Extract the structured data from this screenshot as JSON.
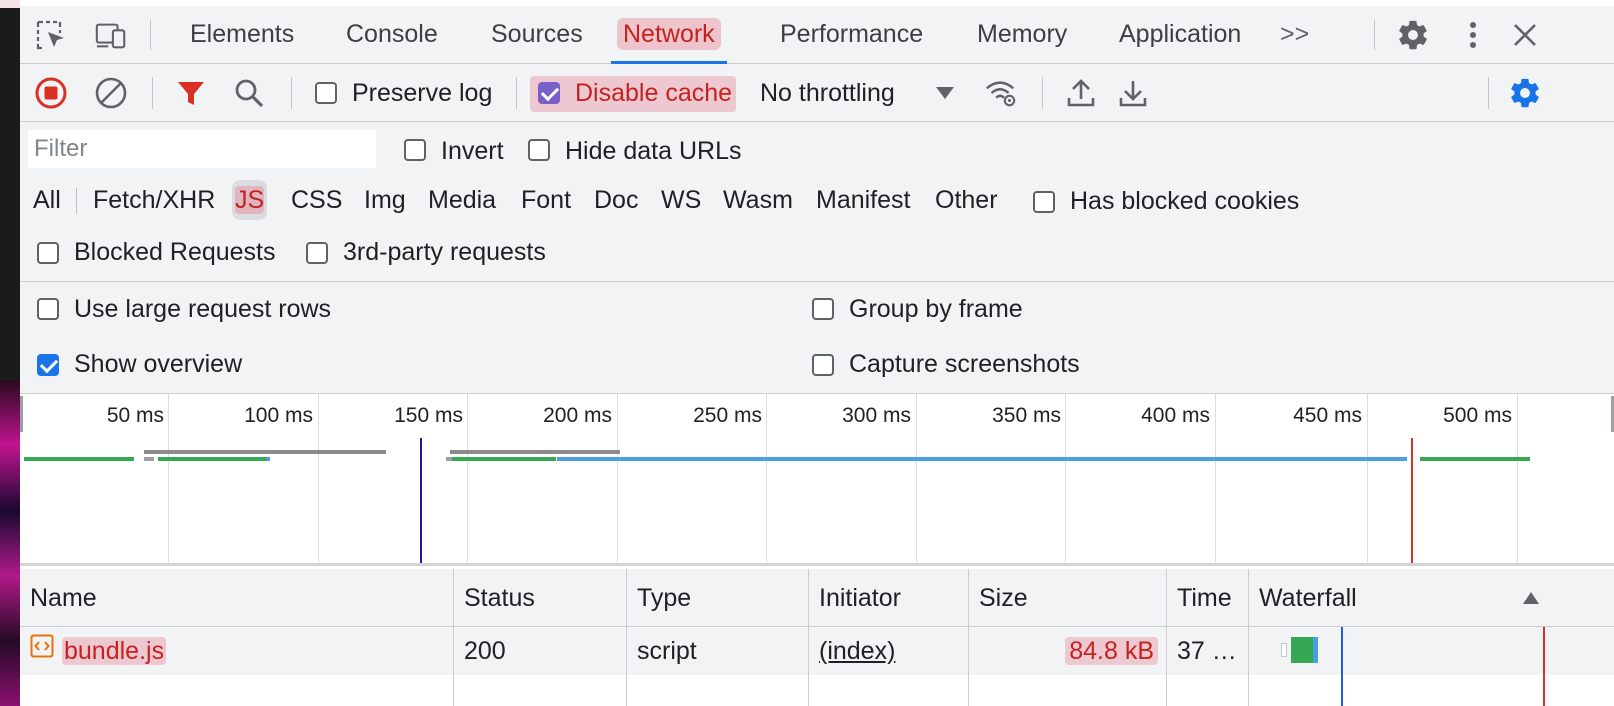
{
  "tabs": {
    "items": [
      "Elements",
      "Console",
      "Sources",
      "Network",
      "Performance",
      "Memory",
      "Application"
    ],
    "active": "Network",
    "more": ">>"
  },
  "toolbar": {
    "preserve_log": "Preserve log",
    "preserve_log_checked": false,
    "disable_cache": "Disable cache",
    "disable_cache_checked": true,
    "throttling": "No throttling"
  },
  "filter": {
    "placeholder": "Filter",
    "invert": "Invert",
    "hide_data_urls": "Hide data URLs",
    "types": [
      "All",
      "Fetch/XHR",
      "JS",
      "CSS",
      "Img",
      "Media",
      "Font",
      "Doc",
      "WS",
      "Wasm",
      "Manifest",
      "Other"
    ],
    "selected_type": "JS",
    "has_blocked_cookies": "Has blocked cookies",
    "blocked_requests": "Blocked Requests",
    "third_party": "3rd-party requests"
  },
  "settings": {
    "large_rows": "Use large request rows",
    "large_rows_checked": false,
    "group_by_frame": "Group by frame",
    "group_by_frame_checked": false,
    "show_overview": "Show overview",
    "show_overview_checked": true,
    "capture_screenshots": "Capture screenshots",
    "capture_screenshots_checked": false
  },
  "overview": {
    "ticks": [
      "50 ms",
      "100 ms",
      "150 ms",
      "200 ms",
      "250 ms",
      "300 ms",
      "350 ms",
      "400 ms",
      "450 ms",
      "500 ms"
    ]
  },
  "table": {
    "columns": [
      "Name",
      "Status",
      "Type",
      "Initiator",
      "Size",
      "Time",
      "Waterfall"
    ],
    "rows": [
      {
        "name": "bundle.js",
        "status": "200",
        "type": "script",
        "initiator": "(index)",
        "size": "84.8 kB",
        "time": "37 …"
      }
    ]
  },
  "colors": {
    "accent": "#1a73e8",
    "record": "#d93025",
    "highlight": "#e7788c",
    "green": "#34a853",
    "blue_bar": "#4a9fe0"
  }
}
